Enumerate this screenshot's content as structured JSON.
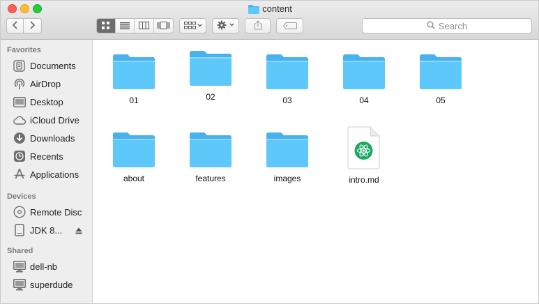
{
  "window": {
    "title": "content"
  },
  "toolbar": {
    "search_placeholder": "Search",
    "icons": {
      "back": "chevron-left-icon",
      "forward": "chevron-right-icon",
      "icon_view": "grid-icon",
      "list_view": "list-icon",
      "column_view": "columns-icon",
      "gallery_view": "cover-flow-icon",
      "arrange": "arrange-icon",
      "action": "gear-icon",
      "share": "share-icon",
      "tag": "tag-icon"
    }
  },
  "sidebar": {
    "favorites_heading": "Favorites",
    "favorites": [
      {
        "label": "Documents",
        "icon": "documents-icon"
      },
      {
        "label": "AirDrop",
        "icon": "airdrop-icon"
      },
      {
        "label": "Desktop",
        "icon": "desktop-icon"
      },
      {
        "label": "iCloud Drive",
        "icon": "cloud-icon"
      },
      {
        "label": "Downloads",
        "icon": "downloads-icon"
      },
      {
        "label": "Recents",
        "icon": "clock-icon"
      },
      {
        "label": "Applications",
        "icon": "applications-icon"
      }
    ],
    "devices_heading": "Devices",
    "devices": [
      {
        "label": "Remote Disc",
        "icon": "disc-icon"
      },
      {
        "label": "JDK 8...",
        "icon": "drive-icon"
      }
    ],
    "shared_heading": "Shared",
    "shared": [
      {
        "label": "dell-nb",
        "icon": "computer-icon"
      },
      {
        "label": "superdude",
        "icon": "computer-icon"
      }
    ]
  },
  "files": [
    {
      "name": "01",
      "kind": "folder"
    },
    {
      "name": "02",
      "kind": "folder"
    },
    {
      "name": "03",
      "kind": "folder"
    },
    {
      "name": "04",
      "kind": "folder"
    },
    {
      "name": "05",
      "kind": "folder"
    },
    {
      "name": "about",
      "kind": "folder"
    },
    {
      "name": "features",
      "kind": "folder"
    },
    {
      "name": "images",
      "kind": "folder"
    },
    {
      "name": "intro.md",
      "kind": "markdown-file"
    }
  ],
  "colors": {
    "folder_front": "#5fc8fb",
    "folder_back": "#48b2ef",
    "atom_green": "#1ea866"
  }
}
